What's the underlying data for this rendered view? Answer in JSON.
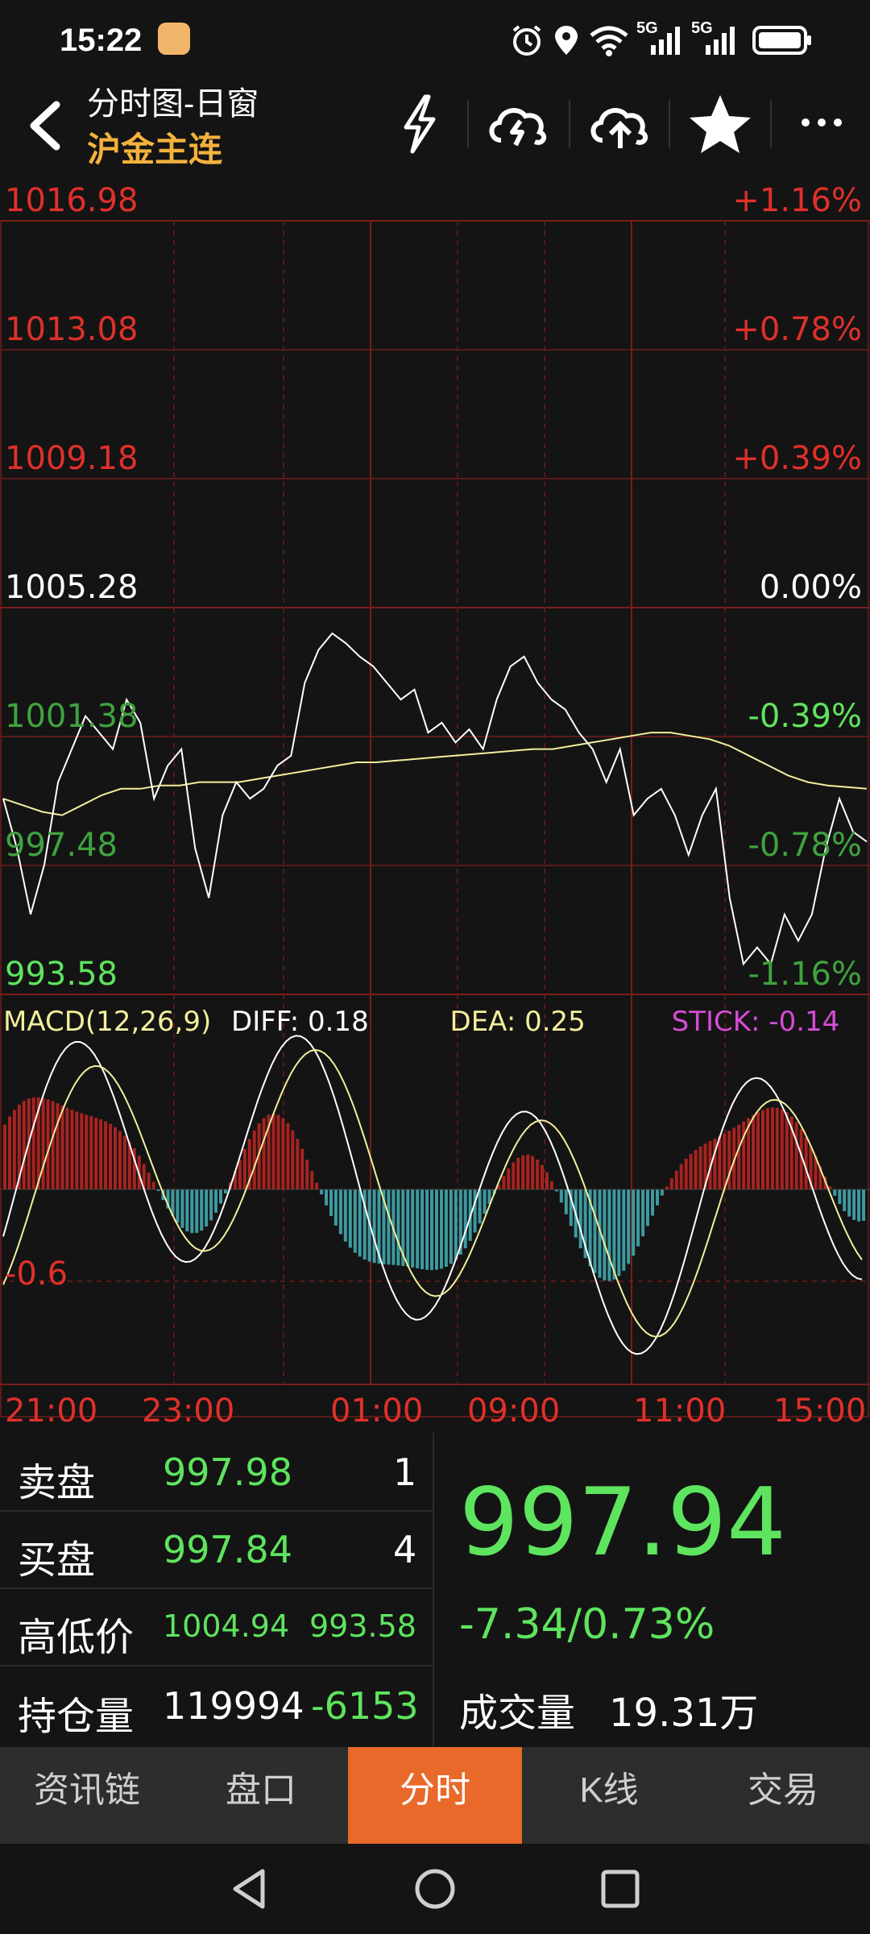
{
  "status_bar": {
    "time": "15:22",
    "network_1": "5G",
    "network_2": "5G"
  },
  "header": {
    "title": "分时图-日窗",
    "subtitle": "沪金主连"
  },
  "price_axis": {
    "left": [
      "1016.98",
      "1013.08",
      "1009.18",
      "1005.28",
      "1001.38",
      "997.48",
      "993.58"
    ],
    "right": [
      "+1.16%",
      "+0.78%",
      "+0.39%",
      "0.00%",
      "-0.39%",
      "-0.78%",
      "-1.16%"
    ]
  },
  "macd": {
    "title": "MACD(12,26,9)",
    "diff": "DIFF: 0.18",
    "dea": "DEA: 0.25",
    "stick": "STICK: -0.14",
    "axis_label": "-0.6"
  },
  "time_axis": [
    "21:00",
    "23:00",
    "01:00",
    "09:00",
    "11:00",
    "15:00"
  ],
  "quote": {
    "sell_label": "卖盘",
    "sell_price": "997.98",
    "sell_qty": "1",
    "buy_label": "买盘",
    "buy_price": "997.84",
    "buy_qty": "4",
    "hl_label": "高低价",
    "high": "1004.94",
    "low": "993.58",
    "oi_label": "持仓量",
    "open_interest": "119994",
    "oi_change": "-6153",
    "last_price": "997.94",
    "change": "-7.34/0.73%",
    "volume_label": "成交量",
    "volume": "19.31万"
  },
  "tabs": [
    {
      "label": "资讯链",
      "active": false
    },
    {
      "label": "盘口",
      "active": false
    },
    {
      "label": "分时",
      "active": true
    },
    {
      "label": "K线",
      "active": false
    },
    {
      "label": "交易",
      "active": false
    }
  ],
  "colors": {
    "up": "#e0302a",
    "down": "#5ee45e",
    "price_line": "#ffffff",
    "avg_line": "#f2ee9c",
    "accent": "#e8692a"
  },
  "chart_data": {
    "type": "line",
    "x_ticks": [
      "21:00",
      "23:00",
      "01:00",
      "09:00",
      "11:00",
      "15:00"
    ],
    "ylim": [
      993.58,
      1016.98
    ],
    "reference": 1005.28,
    "series": [
      {
        "values": [
          999.5,
          998.0,
          996.0,
          997.5,
          1000.0,
          1001.0,
          1002.0,
          1001.5,
          1001.0,
          1002.5,
          1001.8,
          999.5,
          1000.5,
          1001.0,
          998.0,
          996.5,
          999.0,
          1000.0,
          999.5,
          999.8,
          1000.5,
          1000.8,
          1003.0,
          1004.0,
          1004.5,
          1004.2,
          1003.8,
          1003.5,
          1003.0,
          1002.5,
          1002.8,
          1001.5,
          1001.8,
          1001.2,
          1001.6,
          1001.0,
          1002.5,
          1003.5,
          1003.8,
          1003.0,
          1002.5,
          1002.2,
          1001.5,
          1001.0,
          1000.0,
          1001.0,
          999.0,
          999.5,
          999.8,
          999.0,
          997.8,
          999.0,
          999.8,
          996.5,
          994.5,
          995.0,
          994.5,
          996.0,
          995.2,
          996.0,
          998.0,
          999.5,
          998.5,
          998.2
        ]
      },
      {
        "values": [
          999.5,
          999.3,
          999.1,
          999.0,
          999.3,
          999.6,
          999.8,
          999.8,
          999.9,
          999.9,
          1000.0,
          1000.0,
          1000.0,
          1000.1,
          1000.2,
          1000.3,
          1000.4,
          1000.5,
          1000.6,
          1000.6,
          1000.65,
          1000.7,
          1000.75,
          1000.8,
          1000.85,
          1000.9,
          1000.95,
          1001.0,
          1001.0,
          1001.1,
          1001.2,
          1001.3,
          1001.4,
          1001.5,
          1001.5,
          1001.4,
          1001.3,
          1001.1,
          1000.8,
          1000.5,
          1000.2,
          1000.0,
          999.9,
          999.85,
          999.8
        ]
      }
    ]
  }
}
